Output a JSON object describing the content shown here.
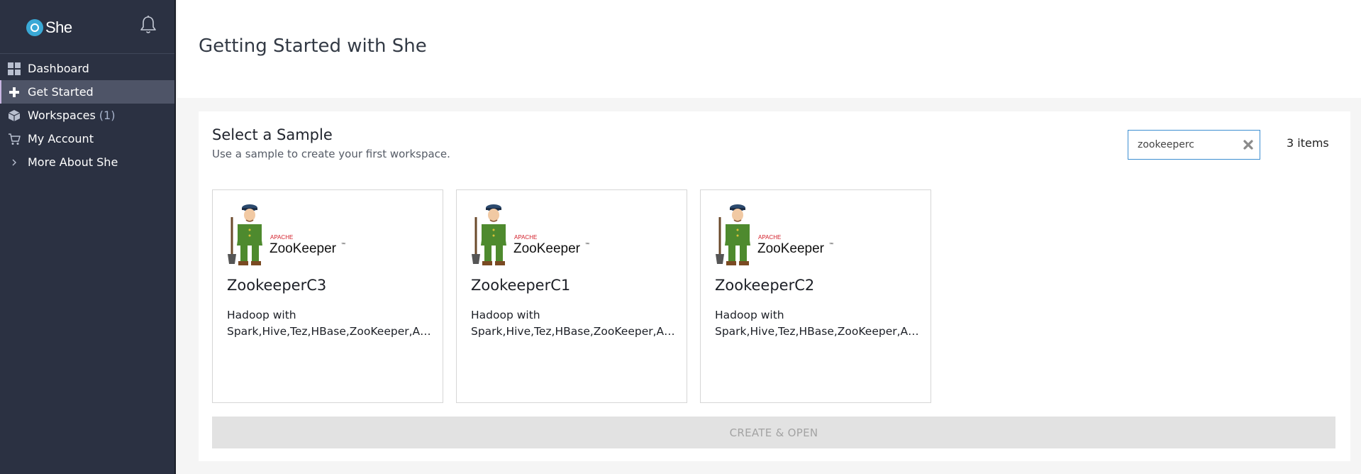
{
  "app": {
    "name": "She"
  },
  "sidebar": {
    "items": [
      {
        "label": "Dashboard",
        "icon": "dashboard-grid-icon"
      },
      {
        "label": "Get Started",
        "icon": "plus-icon",
        "active": true
      },
      {
        "label": "Workspaces",
        "count": "(1)",
        "icon": "cube-icon"
      },
      {
        "label": "My Account",
        "icon": "cart-icon"
      },
      {
        "label": "More About She",
        "icon": "chevron-right-icon"
      }
    ]
  },
  "header": {
    "title": "Getting Started with She"
  },
  "main": {
    "section_title": "Select a Sample",
    "section_subtitle": "Use a sample to create your first workspace.",
    "search": {
      "value": "zookeeperc",
      "placeholder": ""
    },
    "item_count": "3 items",
    "cards": [
      {
        "title": "ZookeeperC3",
        "desc_line1": "Hadoop with",
        "desc_line2": "Spark,Hive,Tez,HBase,ZooKeeper,Ambari",
        "logo_small": "APACHE",
        "logo_big": "ZooKeeper",
        "logo_tm": "™"
      },
      {
        "title": "ZookeeperC1",
        "desc_line1": "Hadoop with",
        "desc_line2": "Spark,Hive,Tez,HBase,ZooKeeper,Ambari",
        "logo_small": "APACHE",
        "logo_big": "ZooKeeper",
        "logo_tm": "™"
      },
      {
        "title": "ZookeeperC2",
        "desc_line1": "Hadoop with",
        "desc_line2": "Spark,Hive,Tez,HBase,ZooKeeper,Ambari",
        "logo_small": "APACHE",
        "logo_big": "ZooKeeper",
        "logo_tm": "™"
      }
    ],
    "create_label": "CREATE & OPEN"
  },
  "colors": {
    "sidebar_bg": "#2b3142",
    "active_item": "#4e5467",
    "accent": "#3d8fd1",
    "logo_blue": "#3aa9d6",
    "logo_red": "#d3202b"
  }
}
